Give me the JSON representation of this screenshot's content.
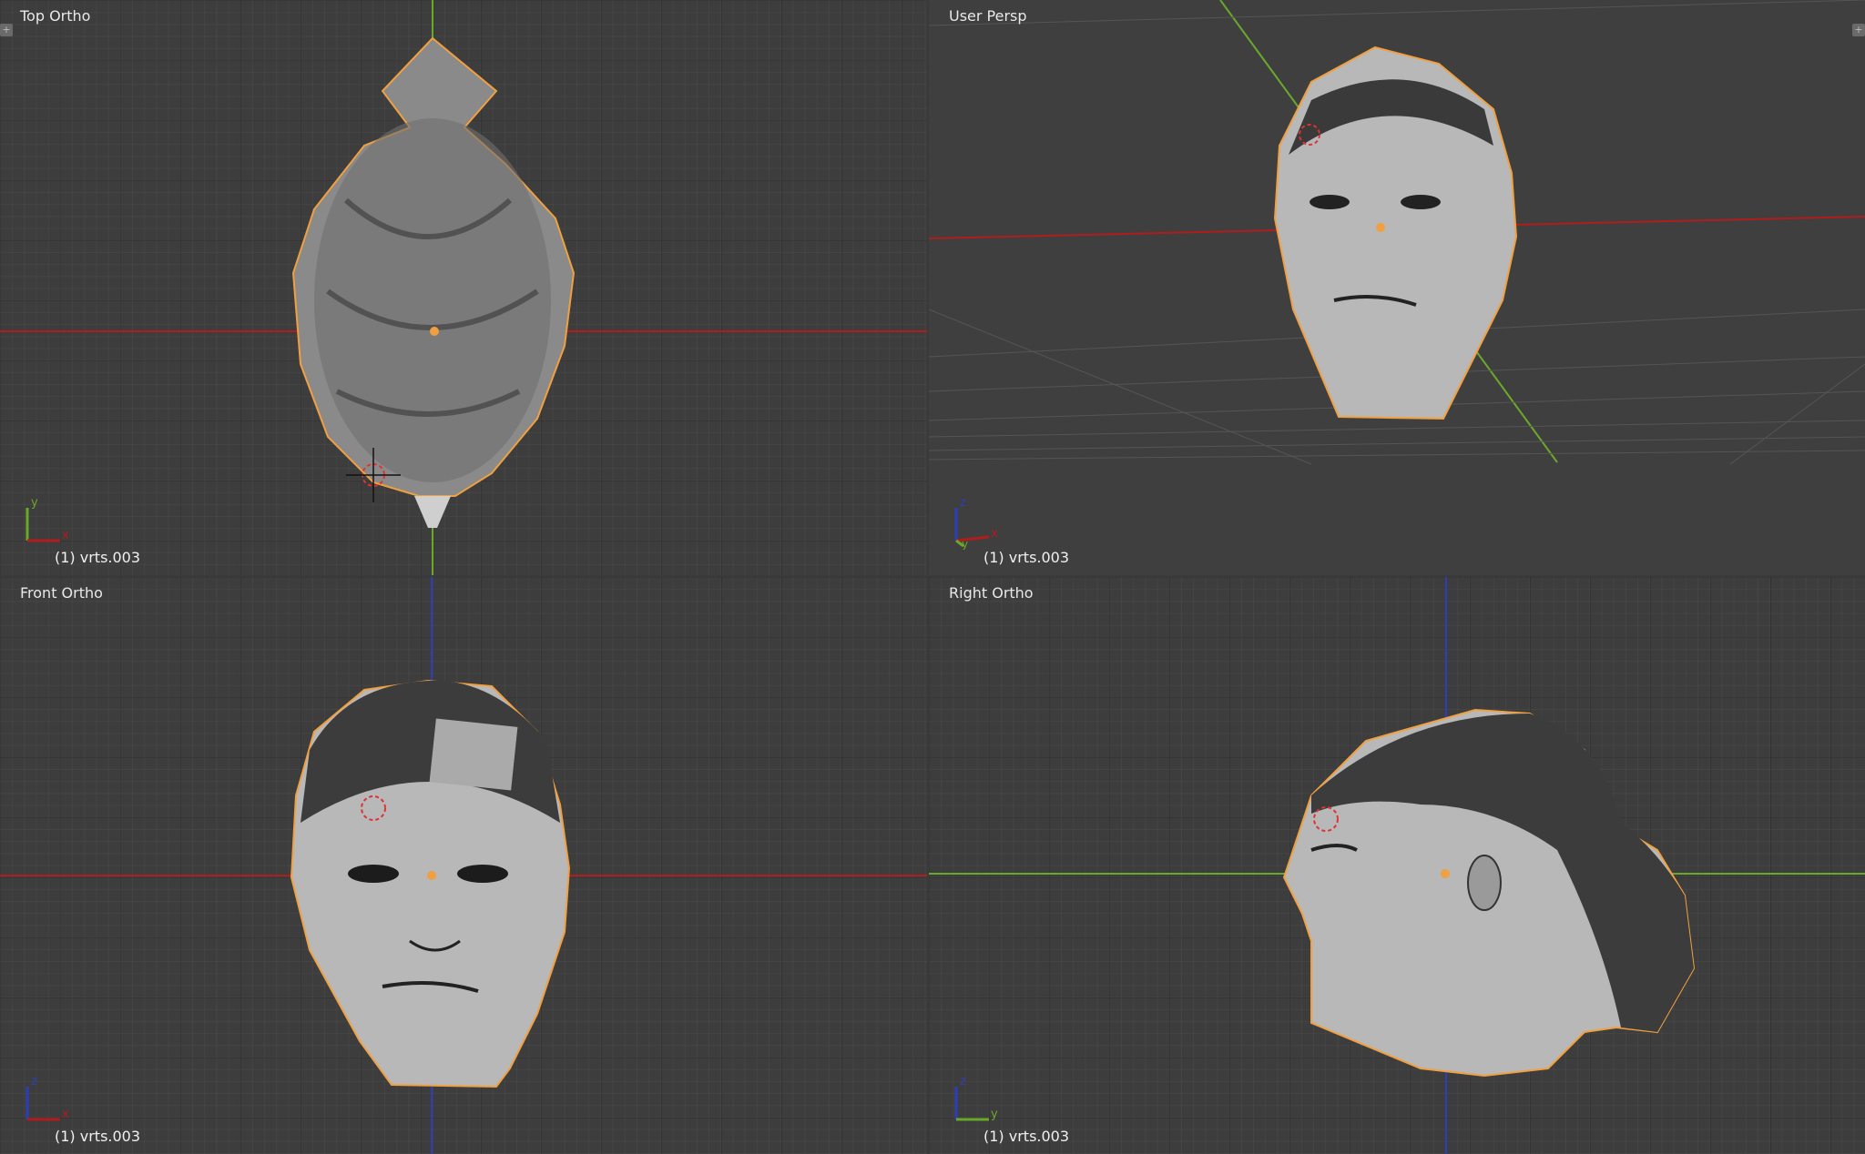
{
  "viewports": {
    "top": {
      "title": "Top Ortho",
      "object": "(1) vrts.003",
      "axis_a": "y",
      "axis_b": "x"
    },
    "persp": {
      "title": "User Persp",
      "object": "(1) vrts.003",
      "axis_a": "z",
      "axis_b": "x",
      "axis_c": "y"
    },
    "front": {
      "title": "Front Ortho",
      "object": "(1) vrts.003",
      "axis_a": "z",
      "axis_b": "x"
    },
    "right": {
      "title": "Right Ortho",
      "object": "(1) vrts.003",
      "axis_a": "z",
      "axis_b": "y"
    }
  },
  "colors": {
    "x_axis": "#b11c1c",
    "y_axis": "#6aa82c",
    "z_axis": "#2d3fb8",
    "outline": "#f0a040",
    "mesh": "#bdbdbd"
  },
  "icons": {
    "corner_left": "plus-icon",
    "corner_right": "plus-icon"
  }
}
